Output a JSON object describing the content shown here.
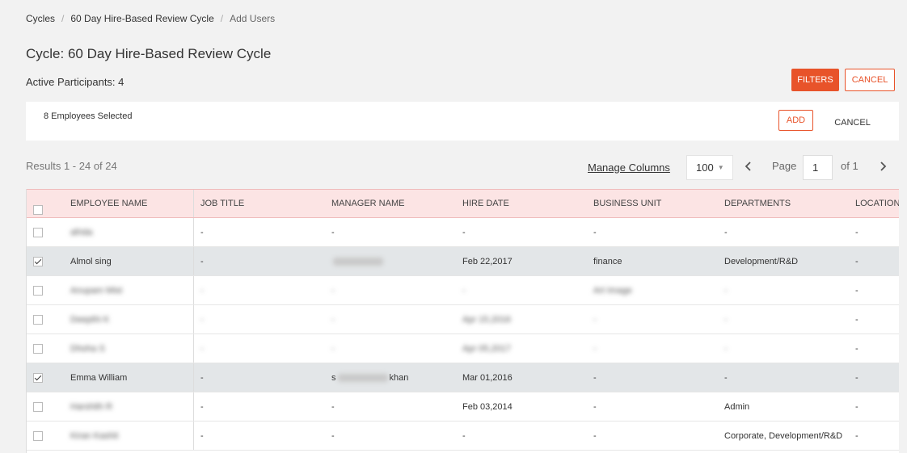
{
  "breadcrumb": [
    "Cycles",
    "60 Day Hire-Based Review Cycle",
    "Add Users"
  ],
  "page_title": "Cycle: 60 Day Hire-Based Review Cycle",
  "active_participants": "Active Participants: 4",
  "buttons": {
    "filters": "FILTERS",
    "cancel_top": "CANCEL",
    "add": "ADD",
    "cancel_bar": "CANCEL"
  },
  "selection": {
    "count_text": "8 Employees Selected"
  },
  "results": {
    "text": "Results 1 - 24 of 24"
  },
  "manage_columns": "Manage Columns",
  "pagination": {
    "per_page": "100",
    "page_label": "Page",
    "page_value": "1",
    "of_label": "of 1"
  },
  "table": {
    "columns": [
      "EMPLOYEE NAME",
      "JOB TITLE",
      "MANAGER NAME",
      "HIRE DATE",
      "BUSINESS UNIT",
      "DEPARTMENTS",
      "LOCATION"
    ],
    "rows": [
      {
        "name": "afrida",
        "job": "-",
        "mgr": "-",
        "hire": "-",
        "bu": "-",
        "dept": "-",
        "loc": "-"
      },
      {
        "name": "Almol sing",
        "job": "-",
        "mgr": "",
        "hire": "Feb 22,2017",
        "bu": "finance",
        "dept": "Development/R&D",
        "loc": "-"
      },
      {
        "name": "Anupam Mist",
        "job": "-",
        "mgr": "-",
        "hire": "-",
        "bu": "Art Image",
        "dept": "-",
        "loc": "-"
      },
      {
        "name": "Deepthi K",
        "job": "-",
        "mgr": "-",
        "hire": "Apr 15,2016",
        "bu": "-",
        "dept": "-",
        "loc": "-"
      },
      {
        "name": "Dhoha S",
        "job": "-",
        "mgr": "-",
        "hire": "Apr 05,2017",
        "bu": "-",
        "dept": "-",
        "loc": "-"
      },
      {
        "name": "Emma William",
        "job": "-",
        "mgr_prefix": "s",
        "mgr_suffix": "khan",
        "hire": "Mar 01,2016",
        "bu": "-",
        "dept": "-",
        "loc": "-"
      },
      {
        "name": "Harshith R",
        "job": "-",
        "mgr": "-",
        "hire": "Feb 03,2014",
        "bu": "-",
        "dept": "Admin",
        "loc": "-"
      },
      {
        "name": "Kiran Kashit",
        "job": "-",
        "mgr": "-",
        "hire": "-",
        "bu": "-",
        "dept": "Corporate, Development/R&D",
        "loc": "-"
      }
    ]
  },
  "colors": {
    "accent": "#e8532a",
    "header_bg": "#fce4e4",
    "selected_row_bg": "#e3e6e8"
  }
}
